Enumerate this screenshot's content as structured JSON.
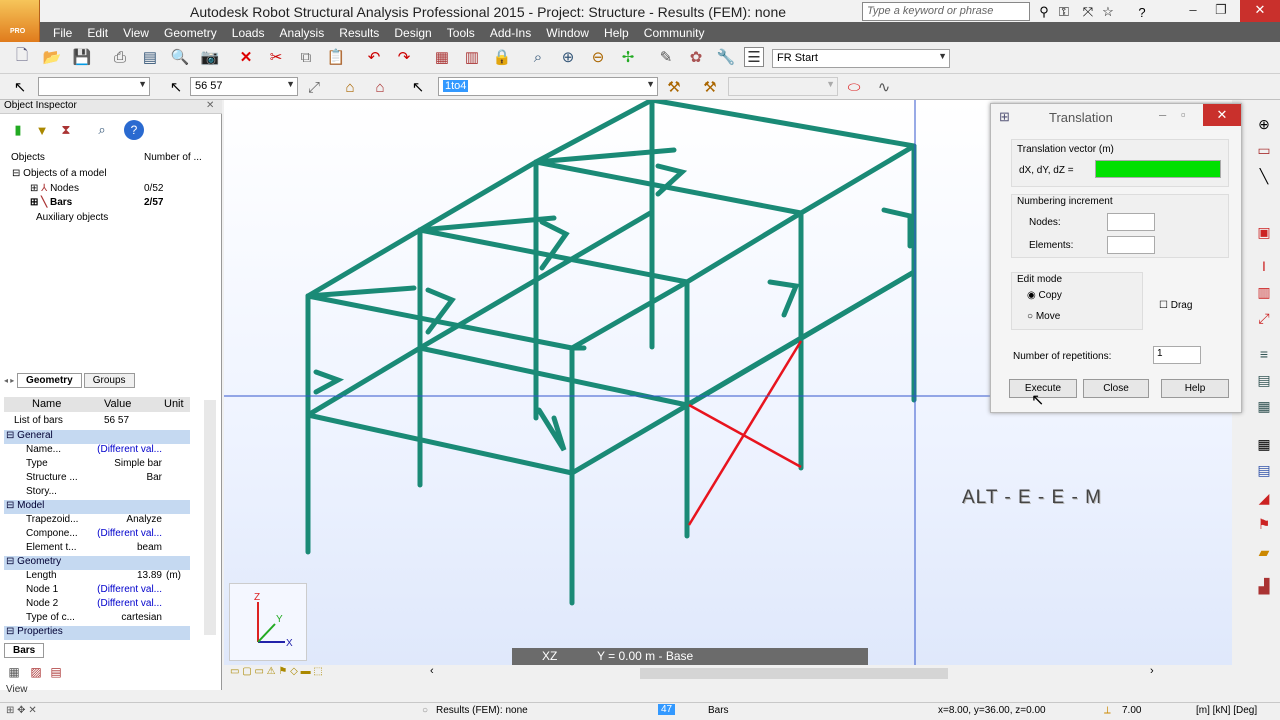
{
  "app": {
    "title": "Autodesk Robot Structural Analysis Professional 2015 - Project: Structure - Results (FEM): none",
    "logo_text": "PRO"
  },
  "search": {
    "placeholder": "Type a keyword or phrase"
  },
  "menu": [
    "File",
    "Edit",
    "View",
    "Geometry",
    "Loads",
    "Analysis",
    "Results",
    "Design",
    "Tools",
    "Add-Ins",
    "Window",
    "Help",
    "Community"
  ],
  "toolbar": {
    "layout_combo": "FR Start",
    "selection_combo": "56 57",
    "case_combo": "1to4"
  },
  "inspector": {
    "title": "Object Inspector",
    "col_objects": "Objects",
    "col_number": "Number of ...",
    "tree": [
      {
        "label": "Objects of a model",
        "count": ""
      },
      {
        "label": "Nodes",
        "count": "0/52"
      },
      {
        "label": "Bars",
        "count": "2/57"
      },
      {
        "label": "Auxiliary objects",
        "count": ""
      }
    ],
    "tabs": [
      "Geometry",
      "Groups"
    ],
    "prop_headers": [
      "Name",
      "Value",
      "Unit"
    ],
    "list_of_bars_label": "List of bars",
    "list_of_bars_value": "56 57",
    "properties": [
      {
        "type": "section",
        "name": "General"
      },
      {
        "name": "Name...",
        "value": "(Different val...",
        "unit": ""
      },
      {
        "name": "Type",
        "value": "Simple bar",
        "unit": ""
      },
      {
        "name": "Structure ...",
        "value": "Bar",
        "unit": ""
      },
      {
        "name": "Story...",
        "value": "",
        "unit": ""
      },
      {
        "type": "section",
        "name": "Model"
      },
      {
        "name": "Trapezoid...",
        "value": "Analyze",
        "unit": ""
      },
      {
        "name": "Compone...",
        "value": "(Different val...",
        "unit": ""
      },
      {
        "name": "Element t...",
        "value": "beam",
        "unit": ""
      },
      {
        "type": "section",
        "name": "Geometry"
      },
      {
        "name": "Length",
        "value": "13.89",
        "unit": "(m)"
      },
      {
        "name": "Node 1",
        "value": "(Different val...",
        "unit": ""
      },
      {
        "name": "Node 2",
        "value": "(Different val...",
        "unit": ""
      },
      {
        "name": "Type of c...",
        "value": "cartesian",
        "unit": ""
      },
      {
        "type": "section",
        "name": "Properties"
      }
    ],
    "bottom_tab": "Bars",
    "view_label": "View"
  },
  "viewport": {
    "annotation": "ALT - E - E - M",
    "view_plane": "XZ",
    "view_level": "Y = 0.00 m - Base"
  },
  "dialog": {
    "title": "Translation",
    "vector_label": "Translation vector (m)",
    "dxyz_label": "dX, dY, dZ =",
    "numbering_label": "Numbering increment",
    "nodes_label": "Nodes:",
    "elements_label": "Elements:",
    "edit_mode_label": "Edit mode",
    "copy_label": "Copy",
    "move_label": "Move",
    "drag_label": "Drag",
    "repetitions_label": "Number of repetitions:",
    "repetitions_value": "1",
    "execute": "Execute",
    "close": "Close",
    "help": "Help"
  },
  "status": {
    "results": "Results (FEM): none",
    "page": "47",
    "bars": "Bars",
    "coords": "x=8.00, y=36.00, z=0.00",
    "value": "7.00",
    "units": "[m] [kN] [Deg]"
  },
  "colors": {
    "structure": "#1a8a76",
    "selected": "#e8141e",
    "vector_field": "#00e000"
  }
}
